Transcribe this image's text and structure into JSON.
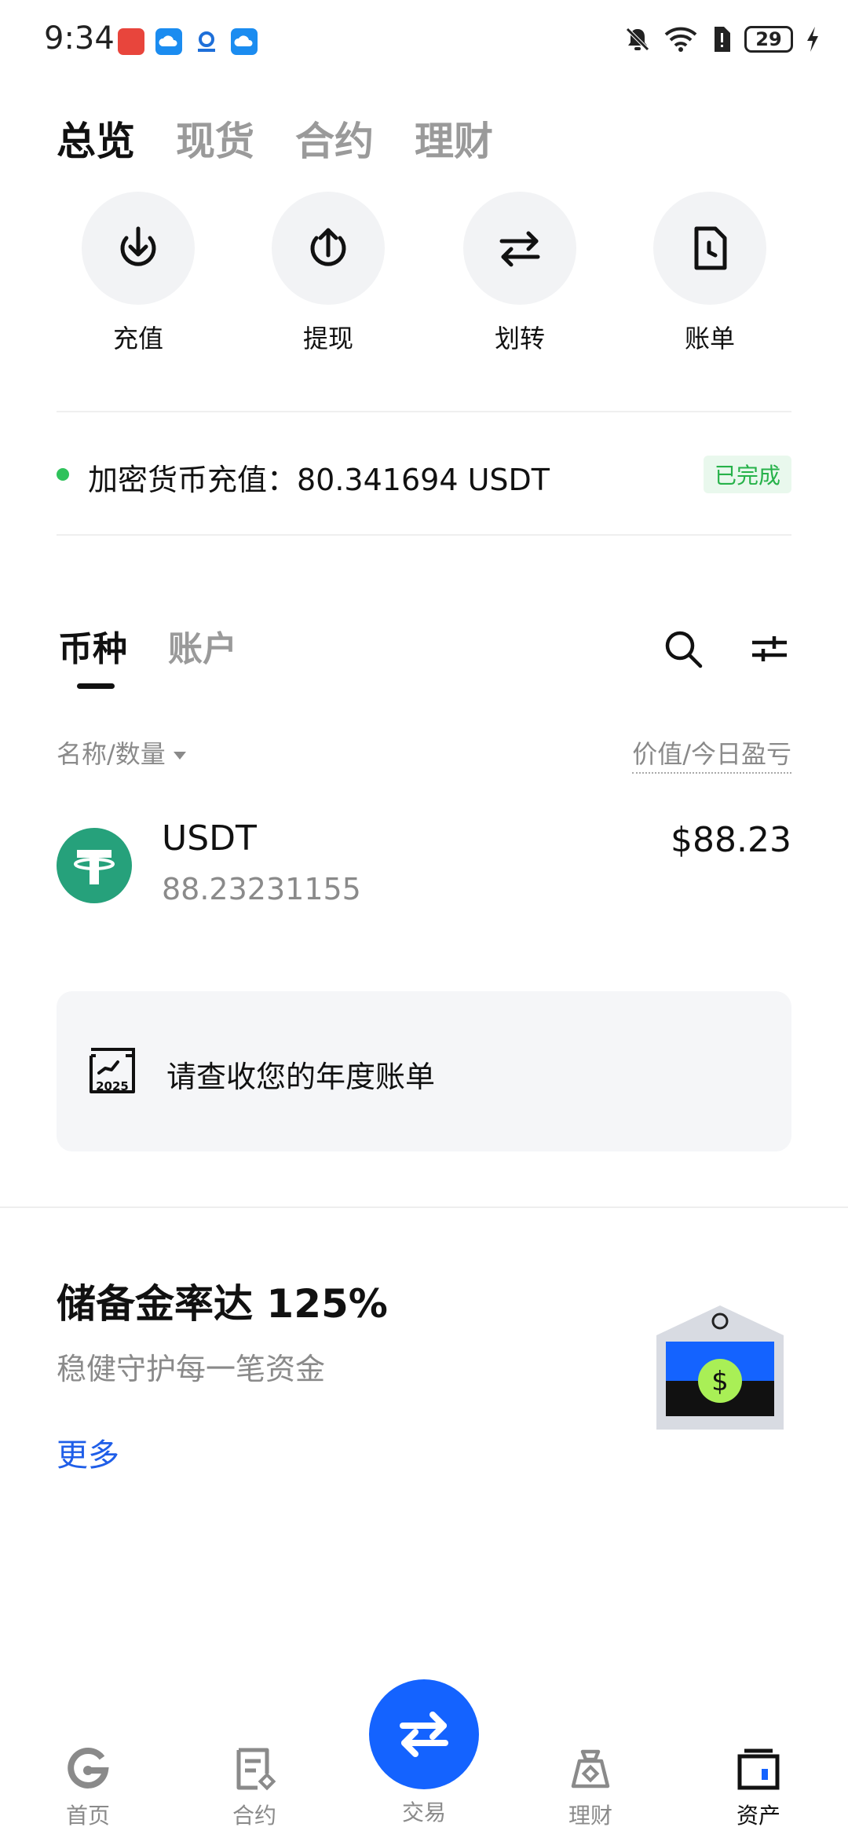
{
  "status_bar": {
    "time": "9:34",
    "battery": "29"
  },
  "top_tabs": [
    {
      "label": "总览",
      "active": true
    },
    {
      "label": "现货",
      "active": false
    },
    {
      "label": "合约",
      "active": false
    },
    {
      "label": "理财",
      "active": false
    }
  ],
  "quick_actions": [
    {
      "label": "充值",
      "icon": "download-circle-icon"
    },
    {
      "label": "提现",
      "icon": "upload-circle-icon"
    },
    {
      "label": "划转",
      "icon": "transfer-arrows-icon"
    },
    {
      "label": "账单",
      "icon": "bill-document-icon"
    }
  ],
  "deposit_notice": {
    "text": "加密货币充值：80.341694 USDT",
    "status": "已完成",
    "status_color": "#27b24a"
  },
  "asset_tabs": [
    {
      "label": "币种",
      "active": true
    },
    {
      "label": "账户",
      "active": false
    }
  ],
  "list_header": {
    "left": "名称/数量",
    "right": "价值/今日盈亏"
  },
  "coins": [
    {
      "name": "USDT",
      "quantity": "88.23231155",
      "value": "$88.23",
      "icon": "tether-icon",
      "color": "#26a17b"
    }
  ],
  "annual_bill": {
    "text": "请查收您的年度账单",
    "icon_year": "2025"
  },
  "reserve": {
    "title": "储备金率达 125%",
    "subtitle": "稳健守护每一笔资金",
    "more": "更多"
  },
  "bottom_nav": [
    {
      "label": "首页",
      "icon": "home-icon",
      "active": false
    },
    {
      "label": "合约",
      "icon": "contract-icon",
      "active": false
    },
    {
      "label": "交易",
      "icon": "trade-swap-icon",
      "active": false
    },
    {
      "label": "理财",
      "icon": "earn-icon",
      "active": false
    },
    {
      "label": "资产",
      "icon": "wallet-icon",
      "active": true
    }
  ],
  "colors": {
    "accent": "#1463ff",
    "link": "#1f5ee8",
    "success": "#2fc25b"
  }
}
